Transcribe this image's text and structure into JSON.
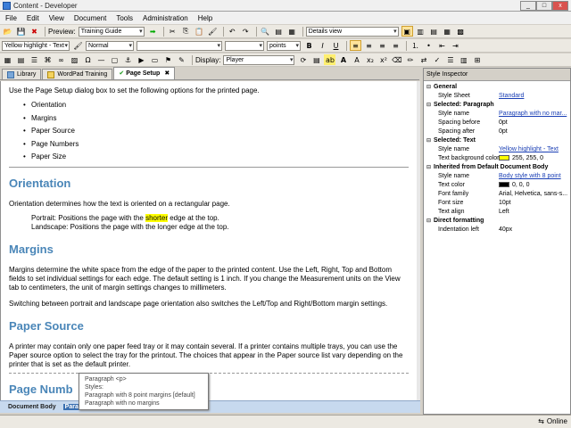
{
  "window": {
    "title": "Content - Developer"
  },
  "menu": [
    "File",
    "Edit",
    "View",
    "Document",
    "Tools",
    "Administration",
    "Help"
  ],
  "toolbar1": {
    "preview_label": "Preview:",
    "preview_value": "Training Guide",
    "view_value": "Details view"
  },
  "toolbar2": {
    "style_value": "Yellow highlight - Text",
    "para_value": "Normal",
    "size_unit": "points"
  },
  "toolbar3": {
    "display_label": "Display:",
    "display_value": "Player"
  },
  "tabs": [
    {
      "label": "Library"
    },
    {
      "label": "WordPad Training"
    },
    {
      "label": "Page Setup"
    }
  ],
  "doc": {
    "intro": "Use the Page Setup dialog box to set the following options for the printed page.",
    "bullets": [
      "Orientation",
      "Margins",
      "Paper Source",
      "Page Numbers",
      "Paper Size"
    ],
    "h_orientation": "Orientation",
    "p_orientation": "Orientation determines how the text is oriented on a rectangular page.",
    "portrait_a": "Portrait: Positions the page with the ",
    "portrait_hl": "shorter",
    "portrait_b": " edge at the top.",
    "landscape": "Landscape: Positions the page with the longer edge at the top.",
    "h_margins": "Margins",
    "p_margins": "Margins determine the white space from the edge of the paper to the printed content. Use the Left, Right, Top and Bottom fields to set individual settings for each edge. The default setting is 1 inch. If you change the Measurement units on the View tab to centimeters, the unit of margin settings changes to millimeters.",
    "p_margins2": "Switching between portrait and landscape page orientation also switches the Left/Top and Right/Bottom margin settings.",
    "h_paper": "Paper Source",
    "p_paper": "A printer may contain only one paper feed tray or it may contain several. If a printer contains multiple trays, you can use the Paper source option to select the tray for the printout. The choices that appear in the Paper source list vary depending on the printer that is set as the default printer.",
    "h_pagenum": "Page Numb"
  },
  "breadcrumb": {
    "item1": "Document Body",
    "item2": "Parag"
  },
  "popup": {
    "line1": "Paragraph <p>",
    "line2": "Styles:",
    "line3": "Paragraph with 8 point margins [default]",
    "line4": "Paragraph with no margins"
  },
  "inspector": {
    "title": "Style Inspector",
    "sections": [
      {
        "name": "General",
        "rows": [
          {
            "k": "Style Sheet",
            "v": "Standard",
            "link": true
          }
        ]
      },
      {
        "name": "Selected: Paragraph",
        "rows": [
          {
            "k": "Style name",
            "v": "Paragraph with no mar...",
            "link": true
          },
          {
            "k": "Spacing before",
            "v": "0pt"
          },
          {
            "k": "Spacing after",
            "v": "0pt"
          }
        ]
      },
      {
        "name": "Selected: Text",
        "rows": [
          {
            "k": "Style name",
            "v": "Yellow highlight - Text",
            "link": true
          },
          {
            "k": "Text background color",
            "v": "255, 255, 0",
            "swatch": "#ffff00"
          }
        ]
      },
      {
        "name": "Inherited from Default Document Body",
        "rows": [
          {
            "k": "Style name",
            "v": "Body style with 8 point",
            "link": true
          },
          {
            "k": "Text color",
            "v": "0, 0, 0",
            "swatch": "#000000"
          },
          {
            "k": "Font family",
            "v": "Arial, Helvetica, sans-s..."
          },
          {
            "k": "Font size",
            "v": "10pt"
          },
          {
            "k": "Text align",
            "v": "Left"
          }
        ]
      },
      {
        "name": "Direct formatting",
        "rows": [
          {
            "k": "Indentation left",
            "v": "40px"
          }
        ]
      }
    ]
  },
  "status": {
    "online": "Online"
  },
  "colors": {
    "heading": "#4a86b8",
    "highlight": "#ffff00",
    "link": "#1a3fb5"
  }
}
